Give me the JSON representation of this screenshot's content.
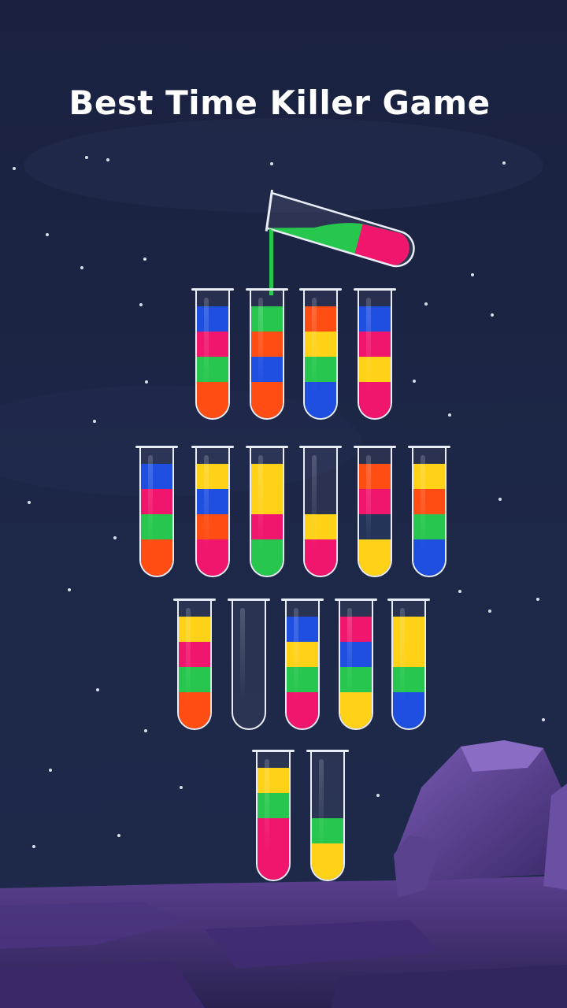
{
  "title": "Best Time Killer Game",
  "colors": {
    "blue": "#1f4fe0",
    "red": "#f0166d",
    "green": "#27c74f",
    "orange": "#ff4d14",
    "yellow": "#ffd117",
    "navy": "#243459"
  },
  "pouring_tube": {
    "label": "pouring-tube",
    "layers": [
      "green",
      "red"
    ]
  },
  "tubes": [
    {
      "row": 1,
      "layers": [
        "blue",
        "red",
        "green",
        "orange"
      ]
    },
    {
      "row": 1,
      "layers": [
        "green",
        "orange",
        "blue",
        "orange"
      ]
    },
    {
      "row": 1,
      "layers": [
        "orange",
        "yellow",
        "green",
        "blue"
      ]
    },
    {
      "row": 1,
      "layers": [
        "blue",
        "red",
        "yellow",
        "red"
      ]
    },
    {
      "row": 2,
      "layers": [
        "blue",
        "red",
        "green",
        "orange"
      ]
    },
    {
      "row": 2,
      "layers": [
        "yellow",
        "blue",
        "orange",
        "red"
      ]
    },
    {
      "row": 2,
      "layers": [
        "yellow",
        "yellow",
        "red",
        "green"
      ]
    },
    {
      "row": 2,
      "layers": [
        "yellow",
        "red"
      ]
    },
    {
      "row": 2,
      "layers": [
        "orange",
        "red",
        "navy",
        "yellow"
      ]
    },
    {
      "row": 2,
      "layers": [
        "yellow",
        "orange",
        "green",
        "blue"
      ]
    },
    {
      "row": 3,
      "layers": [
        "yellow",
        "red",
        "green",
        "orange"
      ]
    },
    {
      "row": 3,
      "layers": []
    },
    {
      "row": 3,
      "layers": [
        "blue",
        "yellow",
        "green",
        "red"
      ]
    },
    {
      "row": 3,
      "layers": [
        "red",
        "blue",
        "green",
        "yellow"
      ]
    },
    {
      "row": 3,
      "layers": [
        "yellow",
        "yellow",
        "green",
        "blue"
      ]
    },
    {
      "row": 4,
      "layers": [
        "yellow",
        "green",
        "red",
        "red"
      ]
    },
    {
      "row": 4,
      "layers": [
        "green",
        "yellow"
      ]
    }
  ]
}
